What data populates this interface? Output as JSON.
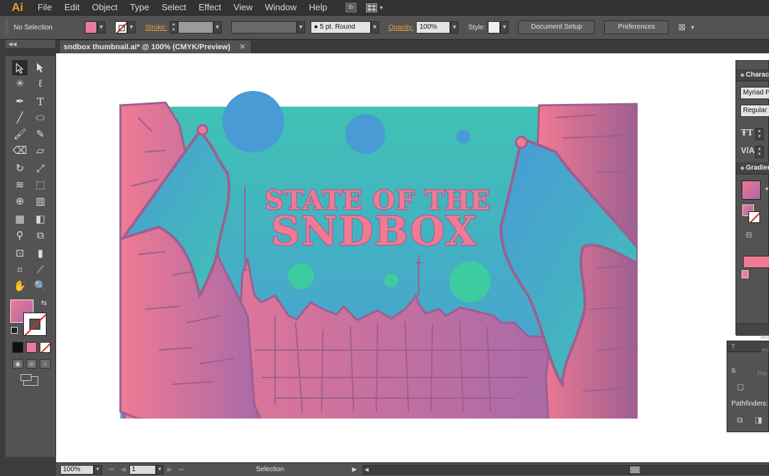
{
  "app": {
    "logo": "Ai"
  },
  "menu": {
    "items": [
      "File",
      "Edit",
      "Object",
      "Type",
      "Select",
      "Effect",
      "View",
      "Window",
      "Help"
    ],
    "bridge_label": "Br"
  },
  "control_bar": {
    "selection_status": "No Selection",
    "stroke_label": "Stroke:",
    "brush_label": "5 pt. Round",
    "opacity_label": "Opacity:",
    "opacity_value": "100%",
    "style_label": "Style:",
    "document_setup_label": "Document Setup",
    "preferences_label": "Preferences",
    "fill_color": "#e57ba0"
  },
  "document": {
    "tab_title": "sndbox thumbnail.ai* @ 100% (CMYK/Preview)",
    "tab_close": "✕"
  },
  "artwork": {
    "title_line1": "STATE OF THE",
    "title_line2": "SNDBOX",
    "colors": {
      "pink": "#f07a93",
      "purple": "#9d5f91",
      "teal": "#3fc2b4",
      "blue": "#4a9ad6",
      "green": "#3fcba0"
    }
  },
  "status_bar": {
    "zoom": "100%",
    "artboard": "1",
    "tool_name": "Selection"
  },
  "panels": {
    "character": {
      "title": "Character",
      "font_family": "Myriad Pro",
      "font_style": "Regular"
    },
    "gradient": {
      "title": "Gradient"
    },
    "pathfinder": {
      "tab_short": "T",
      "shape_modes_short": "S",
      "scale_short": "Sca",
      "align_short": "Ali",
      "profile_short": "Pro",
      "pathfinders_label": "Pathfinders:"
    }
  }
}
